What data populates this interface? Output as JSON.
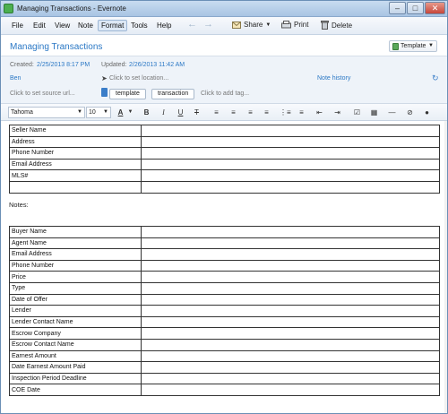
{
  "window": {
    "title": "Managing Transactions - Evernote"
  },
  "menubar": {
    "items": [
      "File",
      "Edit",
      "View",
      "Note",
      "Format",
      "Tools",
      "Help"
    ],
    "share_label": "Share",
    "print_label": "Print",
    "delete_label": "Delete"
  },
  "note": {
    "title": "Managing Transactions",
    "template_label": "Template",
    "created_label": "Created:",
    "created_value": "2/25/2013 8:17 PM",
    "updated_label": "Updated:",
    "updated_value": "2/26/2013 11:42 AM",
    "author": "Ben",
    "location_hint": "Click to set location...",
    "note_history": "Note history",
    "source_url_hint": "Click to set source url...",
    "tags": [
      "template",
      "transaction"
    ],
    "add_tag_hint": "Click to add tag..."
  },
  "format": {
    "font_family": "Tahoma",
    "font_size": "10"
  },
  "content": {
    "seller_table": [
      "Seller Name",
      "Address",
      "Phone Number",
      "Email Address",
      "MLS#",
      ""
    ],
    "notes_label": "Notes:",
    "buyer_table": [
      "Buyer Name",
      "Agent Name",
      "Email Address",
      "Phone Number",
      "Price",
      "Type",
      "Date of Offer",
      "Lender",
      "Lender Contact Name",
      "Escrow Company",
      "Escrow Contact Name",
      "Earnest Amount",
      "Date Earnest Amount Paid",
      "Inspection Period Deadline",
      "COE Date"
    ]
  }
}
